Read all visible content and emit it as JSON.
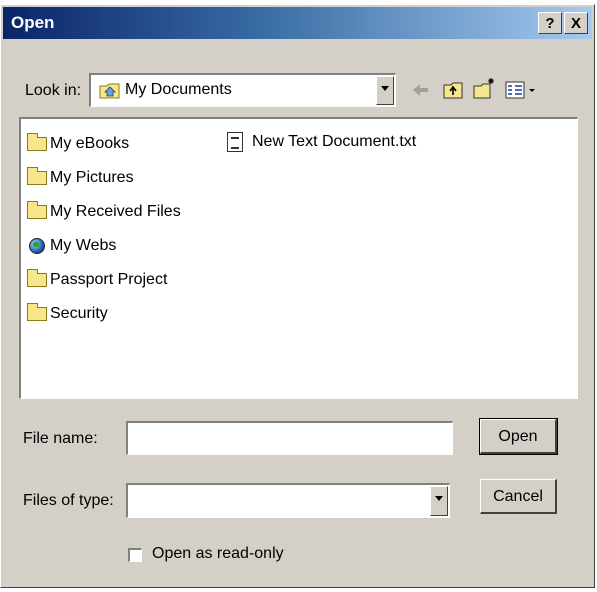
{
  "window": {
    "title": "Open",
    "help_label": "?",
    "close_label": "X"
  },
  "look_in": {
    "label": "Look in:",
    "value": "My Documents"
  },
  "toolbar": {
    "back_icon": "back-arrow-icon",
    "up_icon": "up-folder-icon",
    "new_folder_icon": "new-folder-icon",
    "view_menu_icon": "view-menu-icon"
  },
  "files": [
    {
      "name": "My eBooks",
      "icon": "folder"
    },
    {
      "name": "My Pictures",
      "icon": "folder"
    },
    {
      "name": "My Received Files",
      "icon": "folder"
    },
    {
      "name": "My Webs",
      "icon": "web-folder"
    },
    {
      "name": "Passport Project",
      "icon": "folder"
    },
    {
      "name": "Security",
      "icon": "folder"
    },
    {
      "name": "New Text Document.txt",
      "icon": "text-document"
    }
  ],
  "file_name": {
    "label": "File name:",
    "value": ""
  },
  "files_of_type": {
    "label": "Files of type:",
    "value": ""
  },
  "buttons": {
    "open": "Open",
    "cancel": "Cancel"
  },
  "read_only": {
    "label": "Open as read-only",
    "checked": false
  },
  "colors": {
    "title_bar_start": "#0a246a",
    "title_bar_end": "#a6caf0",
    "dialog_face": "#d4d0c8"
  }
}
